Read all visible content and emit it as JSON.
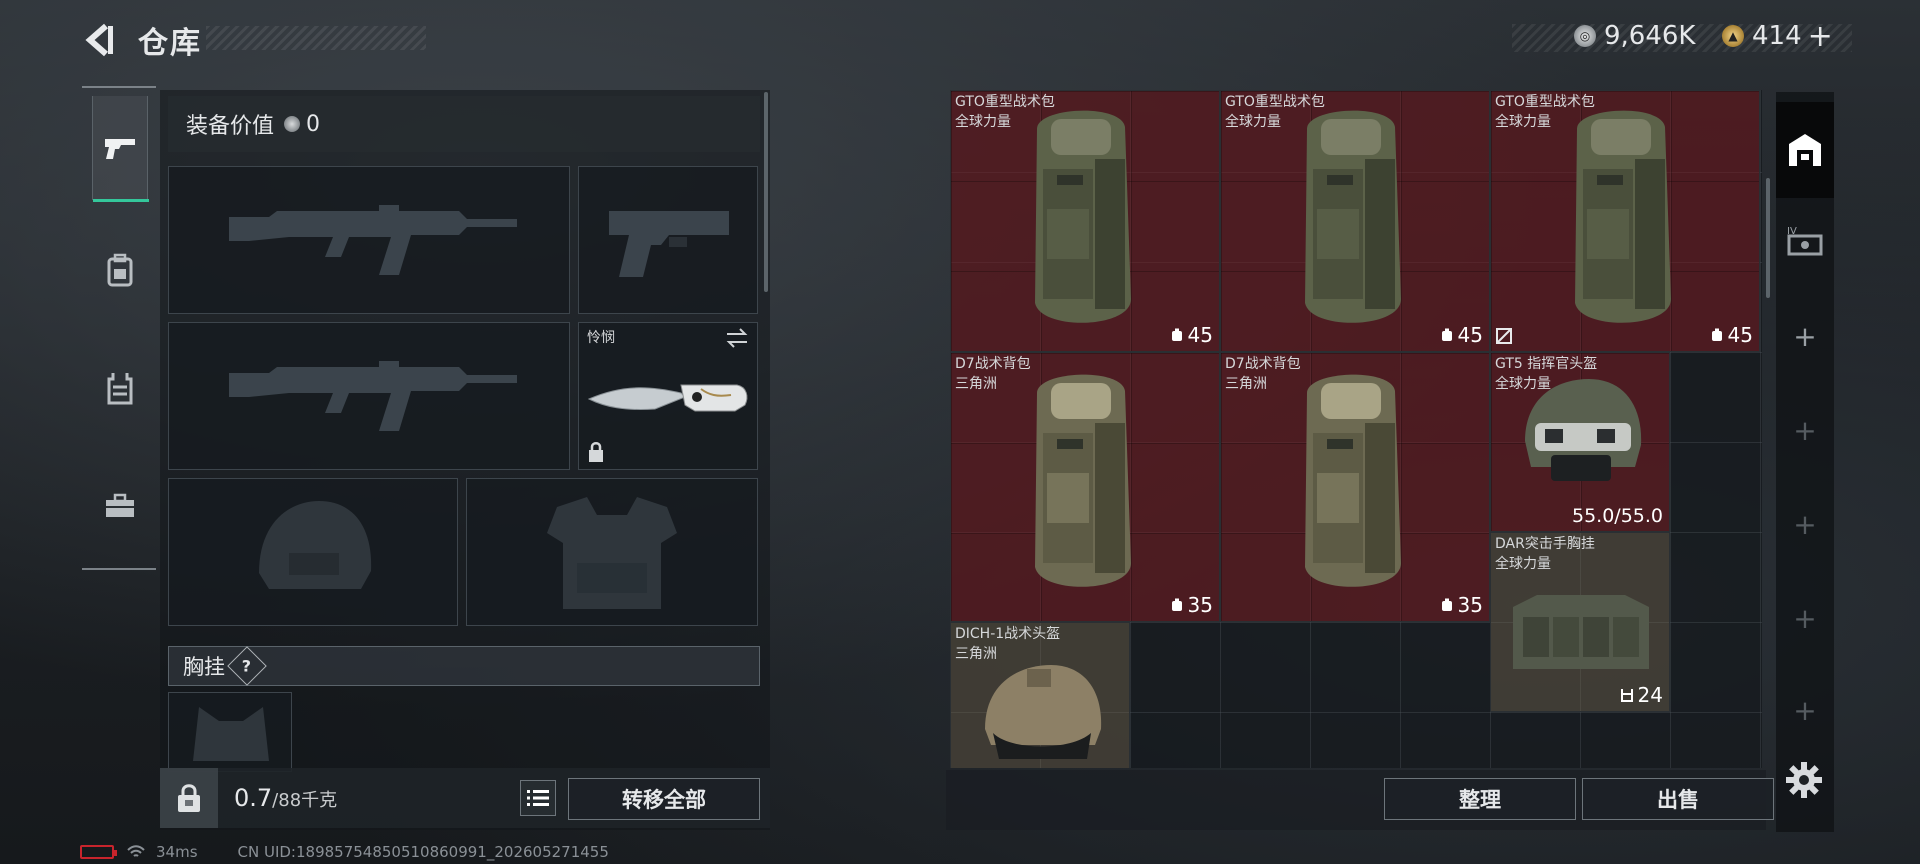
{
  "header": {
    "title": "仓库",
    "currency_silver": "9,646K",
    "currency_gold": "414",
    "gold_plus": "+"
  },
  "left_rail": {
    "items": [
      "pistol-icon",
      "backpack-icon",
      "chest-rig-icon",
      "toolbox-icon"
    ],
    "active_index": 0
  },
  "loadout": {
    "equip_value_label": "装备价值",
    "equip_value": "0",
    "knife_label": "怜悯",
    "chest_rig_label": "胸挂",
    "chest_rig_help": "?",
    "weight_value": "0.7",
    "weight_max": "/88千克",
    "transfer_all": "转移全部"
  },
  "inventory": {
    "items": [
      {
        "name": "GTO重型战术包",
        "sub": "全球力量",
        "count": "45",
        "type": "backpack",
        "color": "red"
      },
      {
        "name": "GTO重型战术包",
        "sub": "全球力量",
        "count": "45",
        "type": "backpack",
        "color": "red"
      },
      {
        "name": "GTO重型战术包",
        "sub": "全球力量",
        "count": "45",
        "type": "backpack",
        "color": "red",
        "no_trade": true
      },
      {
        "name": "D7战术背包",
        "sub": "三角洲",
        "count": "35",
        "type": "backpack",
        "color": "red"
      },
      {
        "name": "D7战术背包",
        "sub": "三角洲",
        "count": "35",
        "type": "backpack",
        "color": "red"
      },
      {
        "name": "GT5 指挥官头盔",
        "sub": "全球力量",
        "count": "55.0/55.0",
        "type": "helmet",
        "color": "red"
      },
      {
        "name": "DAR突击手胸挂",
        "sub": "全球力量",
        "count": "24",
        "type": "rig",
        "color": "tan"
      },
      {
        "name": "DICH-1战术头盔",
        "sub": "三角洲",
        "count": "",
        "type": "helmet2",
        "color": "tan"
      }
    ],
    "sort_label": "整理",
    "sell_label": "出售"
  },
  "right_rail": {
    "items": [
      "storage-icon",
      "case-icon",
      "plus",
      "plus",
      "plus",
      "plus",
      "plus",
      "plus"
    ]
  },
  "status": {
    "ping": "34ms",
    "uid": "CN UID:18985754850510860991_202605271455"
  }
}
